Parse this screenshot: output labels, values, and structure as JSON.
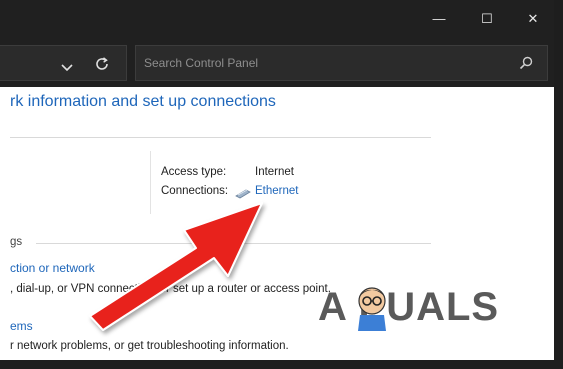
{
  "window": {
    "minimize_glyph": "—",
    "maximize_glyph": "☐",
    "close_glyph": "✕"
  },
  "toolbar": {
    "search_placeholder": "Search Control Panel"
  },
  "page": {
    "title": "rk information and set up connections",
    "access_type_label": "Access type:",
    "access_type_value": "Internet",
    "connections_label": "Connections:",
    "connections_value": "Ethernet",
    "section_heading": "gs",
    "link_new_connection": "ction or network",
    "desc_new_connection": ", dial-up, or VPN connection; or set up a router or access point.",
    "link_troubleshoot": "ems",
    "desc_troubleshoot": "r network problems, or get troubleshooting information."
  },
  "overlay": {
    "watermark_text": "A PUALS",
    "arrow_color": "#e8201c"
  }
}
